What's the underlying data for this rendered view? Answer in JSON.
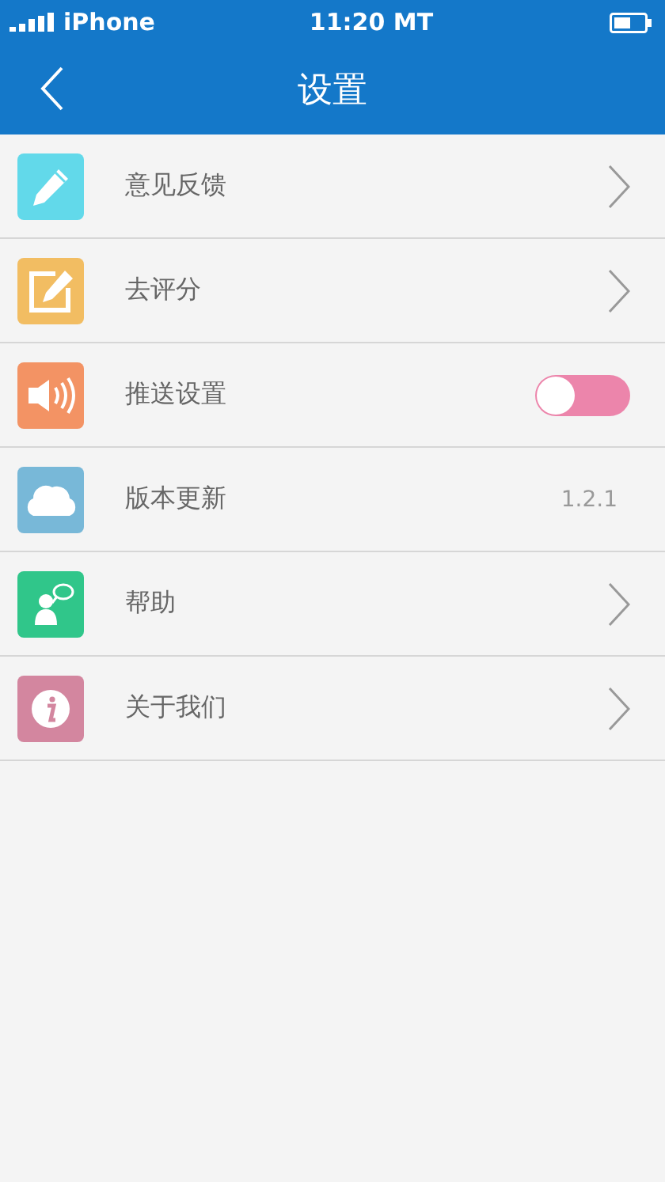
{
  "status_bar": {
    "carrier": "iPhone",
    "time": "11:20 MT"
  },
  "nav": {
    "title": "设置"
  },
  "items": [
    {
      "label": "意见反馈",
      "color": "#62d9ea",
      "kind": "arrow"
    },
    {
      "label": "去评分",
      "color": "#f2bd62",
      "kind": "arrow"
    },
    {
      "label": "推送设置",
      "color": "#f39364",
      "kind": "toggle",
      "on": false
    },
    {
      "label": "版本更新",
      "color": "#78b8d8",
      "kind": "value",
      "value": "1.2.1"
    },
    {
      "label": "帮助",
      "color": "#30c68a",
      "kind": "arrow"
    },
    {
      "label": "关于我们",
      "color": "#d3869f",
      "kind": "arrow"
    }
  ]
}
